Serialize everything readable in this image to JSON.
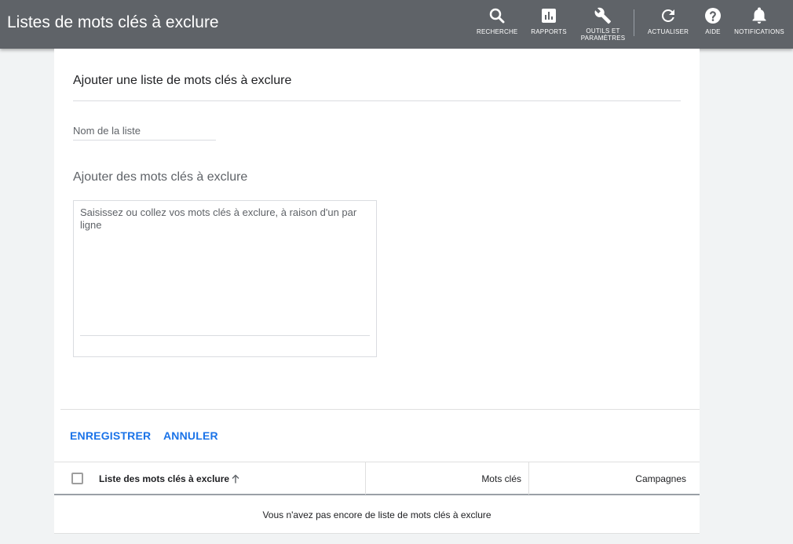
{
  "header": {
    "title": "Listes de mots clés à exclure",
    "buttons": {
      "search": "RECHERCHE",
      "reports": "RAPPORTS",
      "tools_line1": "OUTILS ET",
      "tools_line2": "PARAMÈTRES",
      "refresh": "ACTUALISER",
      "help": "AIDE",
      "notifications": "NOTIFICATIONS"
    },
    "icons": {
      "search": "search-icon",
      "reports": "bar-chart-icon",
      "tools": "wrench-icon",
      "refresh": "refresh-icon",
      "help": "help-icon",
      "notifications": "bell-icon"
    },
    "background": "#5f6368"
  },
  "form": {
    "title": "Ajouter une liste de mots clés à exclure",
    "list_name_placeholder": "Nom de la liste",
    "list_name_value": "",
    "keywords_title": "Ajouter des mots clés à exclure",
    "keywords_placeholder": "Saisissez ou collez vos mots clés à exclure, à raison d'un par ligne",
    "keywords_value": ""
  },
  "actions": {
    "save": "ENREGISTRER",
    "cancel": "ANNULER",
    "accent": "#1a73e8"
  },
  "table": {
    "columns": {
      "name": "Liste des mots clés à exclure",
      "keywords": "Mots clés",
      "campaigns": "Campagnes"
    },
    "sort": "ascending",
    "empty_message": "Vous n'avez pas encore de liste de mots clés à exclure"
  }
}
